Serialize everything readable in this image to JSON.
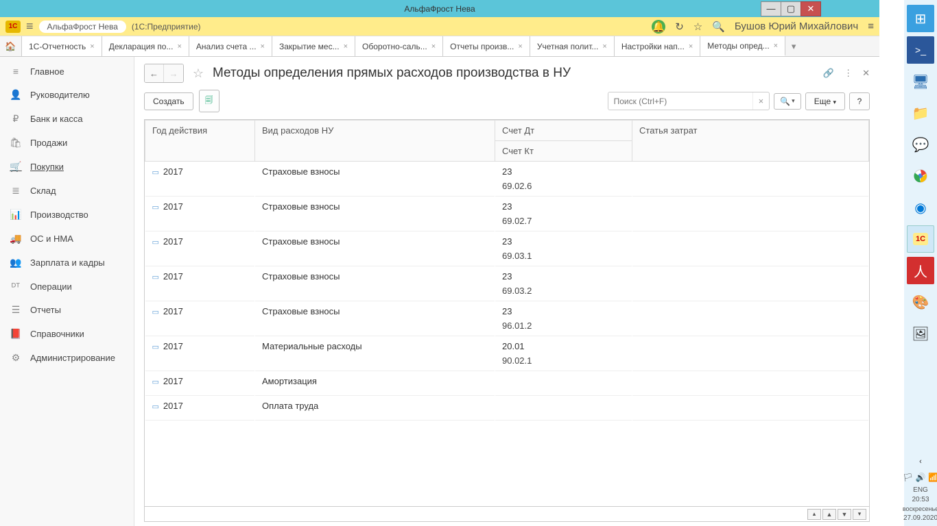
{
  "window": {
    "title": "АльфаФрост Нева"
  },
  "app": {
    "name": "АльфаФрост Нева",
    "suffix": "(1С:Предприятие)",
    "user": "Бушов Юрий Михайлович"
  },
  "tabs": [
    {
      "label": "1С-Отчетность"
    },
    {
      "label": "Декларация по..."
    },
    {
      "label": "Анализ счета ..."
    },
    {
      "label": "Закрытие мес..."
    },
    {
      "label": "Оборотно-саль..."
    },
    {
      "label": "Отчеты произв..."
    },
    {
      "label": "Учетная полит..."
    },
    {
      "label": "Настройки нап..."
    },
    {
      "label": "Методы опред..."
    }
  ],
  "sidebar": [
    {
      "icon": "≡",
      "label": "Главное"
    },
    {
      "icon": "👤",
      "label": "Руководителю"
    },
    {
      "icon": "₽",
      "label": "Банк и касса"
    },
    {
      "icon": "🛍",
      "label": "Продажи"
    },
    {
      "icon": "🛒",
      "label": "Покупки",
      "selected": true
    },
    {
      "icon": "≣",
      "label": "Склад"
    },
    {
      "icon": "📊",
      "label": "Производство"
    },
    {
      "icon": "🚚",
      "label": "ОС и НМА"
    },
    {
      "icon": "👥",
      "label": "Зарплата и кадры"
    },
    {
      "icon": "ᴰᵀ",
      "label": "Операции"
    },
    {
      "icon": "☰",
      "label": "Отчеты"
    },
    {
      "icon": "📕",
      "label": "Справочники"
    },
    {
      "icon": "⚙",
      "label": "Администрирование"
    }
  ],
  "page": {
    "title": "Методы определения прямых расходов производства в НУ",
    "create_btn": "Создать",
    "more_btn": "Еще",
    "search_placeholder": "Поиск (Ctrl+F)"
  },
  "table": {
    "headers": {
      "year": "Год действия",
      "type": "Вид расходов НУ",
      "dt": "Счет Дт",
      "kt": "Счет Кт",
      "article": "Статья затрат"
    },
    "rows": [
      {
        "year": "2017",
        "type": "Страховые взносы",
        "dt": "23",
        "kt": "69.02.6",
        "article": ""
      },
      {
        "year": "2017",
        "type": "Страховые взносы",
        "dt": "23",
        "kt": "69.02.7",
        "article": ""
      },
      {
        "year": "2017",
        "type": "Страховые взносы",
        "dt": "23",
        "kt": "69.03.1",
        "article": ""
      },
      {
        "year": "2017",
        "type": "Страховые взносы",
        "dt": "23",
        "kt": "69.03.2",
        "article": ""
      },
      {
        "year": "2017",
        "type": "Страховые взносы",
        "dt": "23",
        "kt": "96.01.2",
        "article": ""
      },
      {
        "year": "2017",
        "type": "Материальные расходы",
        "dt": "20.01",
        "kt": "90.02.1",
        "article": ""
      },
      {
        "year": "2017",
        "type": "Амортизация",
        "dt": "",
        "kt": "",
        "article": ""
      },
      {
        "year": "2017",
        "type": "Оплата труда",
        "dt": "",
        "kt": "",
        "article": ""
      }
    ]
  },
  "tray": {
    "lang": "ENG",
    "time": "20:53",
    "day": "воскресенье",
    "date": "27.09.2020"
  }
}
